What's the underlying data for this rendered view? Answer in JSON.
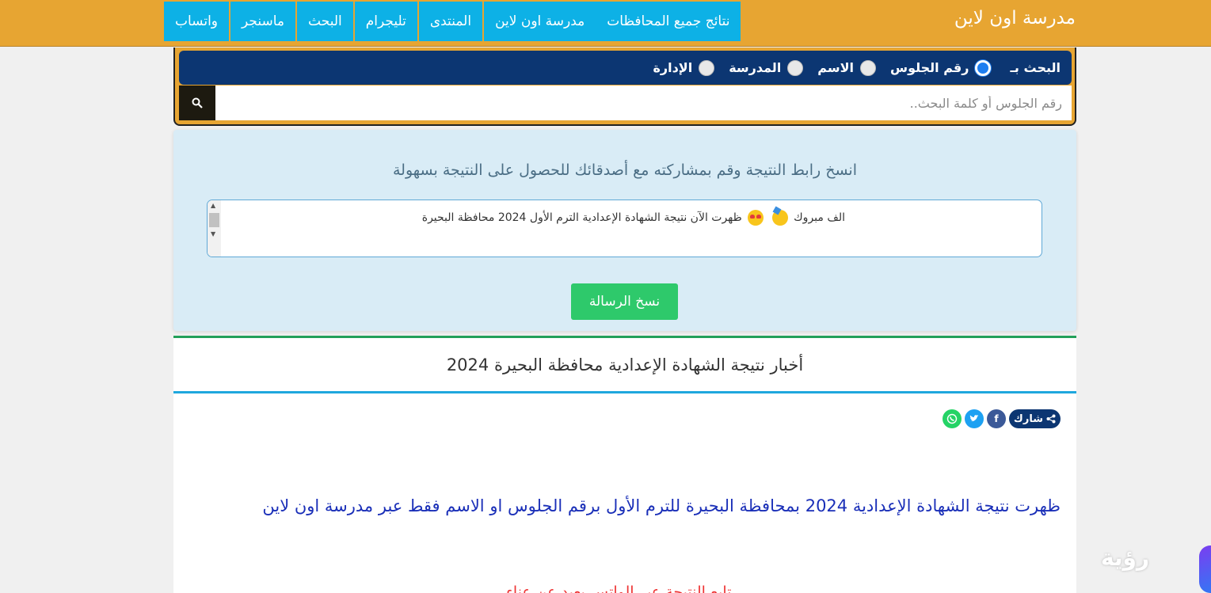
{
  "header": {
    "site_title": "مدرسة اون لاين",
    "nav": [
      {
        "label": "نتائج جميع المحافظات"
      },
      {
        "label": "مدرسة اون لاين"
      },
      {
        "label": "المنتدى"
      },
      {
        "label": "تليجرام"
      },
      {
        "label": "البحث"
      },
      {
        "label": "ماسنجر"
      },
      {
        "label": "واتساب"
      }
    ],
    "colors": {
      "bar": "#e7a532",
      "nav": "#0db1e6"
    }
  },
  "search": {
    "label": "البحث بـ",
    "options": [
      {
        "label": "رقم الجلوس",
        "checked": true
      },
      {
        "label": "الاسم",
        "checked": false
      },
      {
        "label": "المدرسة",
        "checked": false
      },
      {
        "label": "الإدارة",
        "checked": false
      }
    ],
    "placeholder": "رقم الجلوس أو كلمة البحث..",
    "button_icon": "search-icon"
  },
  "share": {
    "heading": "انسخ رابط النتيجة وقم بمشاركته مع أصدقائك للحصول على النتيجة بسهولة",
    "message_prefix": "الف مبروك",
    "message_text": "ظهرت الآن نتيجة الشهادة الإعدادية الترم الأول 2024 محافظة البحيرة",
    "message_second_line": "ــ ــ ــ ــ ــ ــ ــ ــ ــ ــ ــ ــ ــ ــ ــ ــ ــ ــ ــ ــ ــ ــ ــ ــ ــ ــ ــ ــ",
    "copy_label": "نسخ الرسالة"
  },
  "news": {
    "title": "أخبار نتيجة الشهادة الإعدادية محافظة البحيرة 2024",
    "share_label": "شارك",
    "social": [
      "f",
      "t",
      "w"
    ],
    "headline": "ظهرت نتيجة الشهادة الإعدادية 2024 بمحافظة البحيرة للترم الأول برقم الجلوس او الاسم فقط عبر مدرسة اون لاين",
    "red_line": "تابع النتيجة عبر الواتس بعيد عن عناء"
  },
  "watermark": "رؤية"
}
